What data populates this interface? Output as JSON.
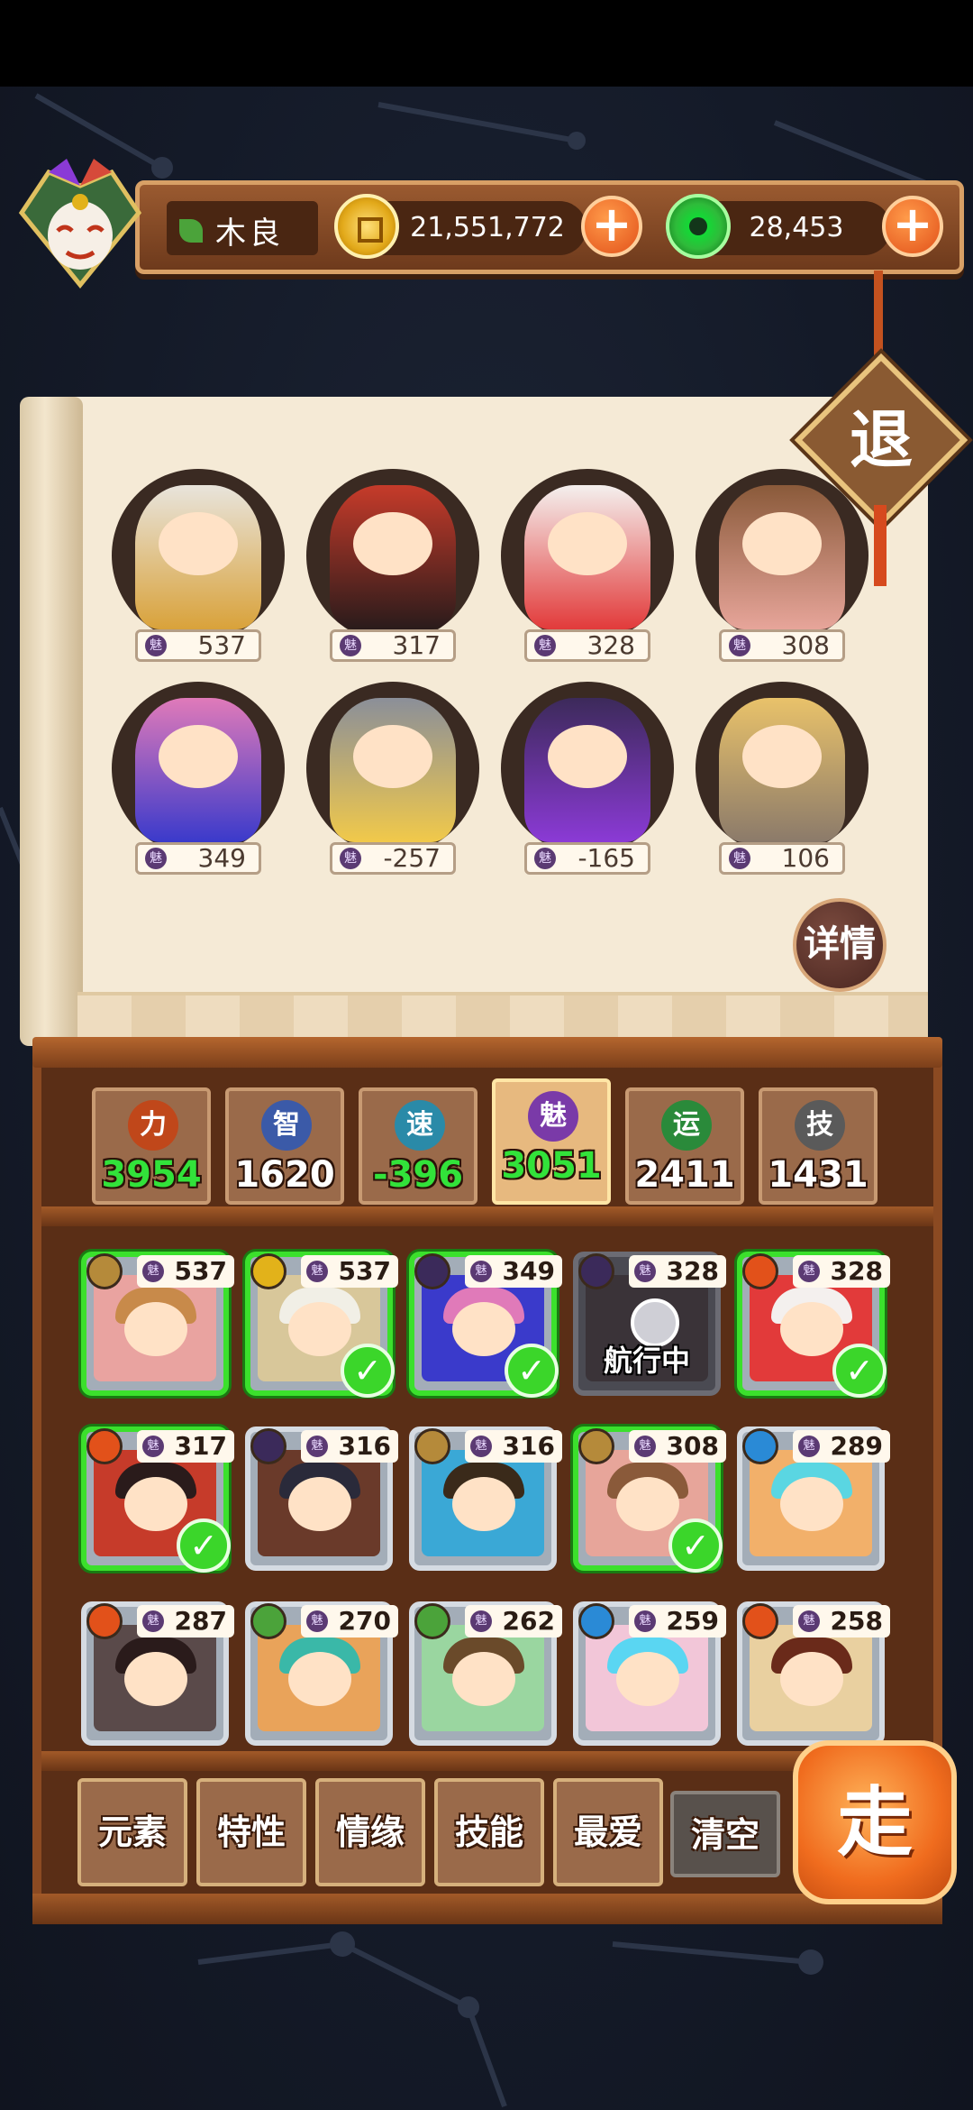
{
  "player": {
    "name": "木良"
  },
  "resources": {
    "gold": "21,551,772",
    "jade": "28,453"
  },
  "exit_label": "退",
  "details_label": "详情",
  "featured": [
    {
      "value": "537",
      "palette": [
        "#e8e4dc",
        "#d9a23a"
      ]
    },
    {
      "value": "317",
      "palette": [
        "#c63b2a",
        "#2a1b1b"
      ]
    },
    {
      "value": "328",
      "palette": [
        "#f4f0ee",
        "#e23a3a"
      ]
    },
    {
      "value": "308",
      "palette": [
        "#8a5a3a",
        "#e7a59a"
      ]
    },
    {
      "value": "349",
      "palette": [
        "#e07ab9",
        "#3a3acb"
      ]
    },
    {
      "value": "-257",
      "palette": [
        "#8b8f99",
        "#f1c94a"
      ]
    },
    {
      "value": "-165",
      "palette": [
        "#3c2a5a",
        "#8b3ad6"
      ]
    },
    {
      "value": "106",
      "palette": [
        "#e9c26a",
        "#8b7a6a"
      ]
    }
  ],
  "charm_label": "魅",
  "stats": [
    {
      "icon": "力",
      "value": "3954",
      "color": "#c0471a",
      "green": true,
      "active": false
    },
    {
      "icon": "智",
      "value": "1620",
      "color": "#3b5aa8",
      "green": false,
      "active": false
    },
    {
      "icon": "速",
      "value": "-396",
      "color": "#2a8aa8",
      "green": true,
      "active": false
    },
    {
      "icon": "魅",
      "value": "3051",
      "color": "#7a3aa8",
      "green": true,
      "active": true
    },
    {
      "icon": "运",
      "value": "2411",
      "color": "#2a8a3a",
      "green": false,
      "active": false
    },
    {
      "icon": "技",
      "value": "1431",
      "color": "#5a5a5a",
      "green": false,
      "active": false
    }
  ],
  "heroes": [
    {
      "value": "537",
      "elem": "#b58a3a",
      "hair": "#c88a4a",
      "bg": "#e9a3a0",
      "selected": true,
      "checked": false,
      "sailing": false
    },
    {
      "value": "537",
      "elem": "#e2b21a",
      "hair": "#f1efe6",
      "bg": "#d8c79a",
      "selected": true,
      "checked": true,
      "sailing": false
    },
    {
      "value": "349",
      "elem": "#3b2a5a",
      "hair": "#e07ab9",
      "bg": "#3a3acb",
      "selected": true,
      "checked": true,
      "sailing": false
    },
    {
      "value": "328",
      "elem": "#3b2a5a",
      "hair": "#5a4a5a",
      "bg": "#3a3338",
      "selected": false,
      "checked": false,
      "sailing": true,
      "sail_label": "航行中"
    },
    {
      "value": "328",
      "elem": "#e2511a",
      "hair": "#f4f0ee",
      "bg": "#e23a3a",
      "selected": true,
      "checked": true,
      "sailing": false
    },
    {
      "value": "317",
      "elem": "#e2511a",
      "hair": "#2a1b1b",
      "bg": "#c63b2a",
      "selected": true,
      "checked": true,
      "sailing": false
    },
    {
      "value": "316",
      "elem": "#3b2a5a",
      "hair": "#2a2a3a",
      "bg": "#6a3a2a",
      "selected": false,
      "checked": false,
      "sailing": false
    },
    {
      "value": "316",
      "elem": "#b58a3a",
      "hair": "#3a2a1a",
      "bg": "#3aa8d6",
      "selected": false,
      "checked": false,
      "sailing": false
    },
    {
      "value": "308",
      "elem": "#b58a3a",
      "hair": "#8a5a3a",
      "bg": "#e7a59a",
      "selected": true,
      "checked": true,
      "sailing": false
    },
    {
      "value": "289",
      "elem": "#2a8ad6",
      "hair": "#5ad6e2",
      "bg": "#f2b06a",
      "selected": false,
      "checked": false,
      "sailing": false
    },
    {
      "value": "287",
      "elem": "#e2511a",
      "hair": "#2a1b1b",
      "bg": "#5a4a4a",
      "selected": false,
      "checked": false,
      "sailing": false
    },
    {
      "value": "270",
      "elem": "#4ba33a",
      "hair": "#3ab8a8",
      "bg": "#e9a35a",
      "selected": false,
      "checked": false,
      "sailing": false
    },
    {
      "value": "262",
      "elem": "#4ba33a",
      "hair": "#6a4a2a",
      "bg": "#9ad6a0",
      "selected": false,
      "checked": false,
      "sailing": false
    },
    {
      "value": "259",
      "elem": "#2a8ad6",
      "hair": "#5ad6f2",
      "bg": "#f2c6d8",
      "selected": false,
      "checked": false,
      "sailing": false
    },
    {
      "value": "258",
      "elem": "#e2511a",
      "hair": "#6a2a1a",
      "bg": "#e9d0a0",
      "selected": false,
      "checked": false,
      "sailing": false
    }
  ],
  "filters": [
    "元素",
    "特性",
    "情缘",
    "技能",
    "最爱"
  ],
  "clear_label": "清空",
  "go_label": "走"
}
